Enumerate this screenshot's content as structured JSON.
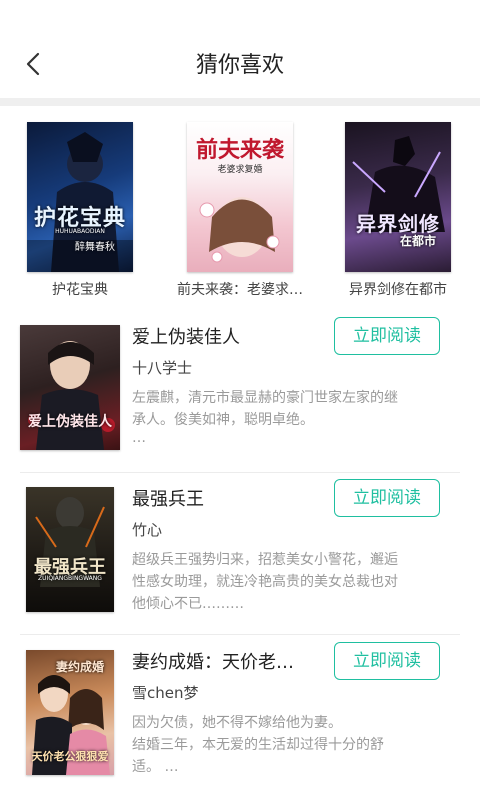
{
  "header": {
    "title": "猜你喜欢",
    "back_icon": "chevron-left-icon"
  },
  "featured": [
    {
      "title": "护花宝典",
      "cover_text": "护花宝典",
      "cover_sub": "醉舞春秋",
      "cover_en": "HUHUABAODIAN"
    },
    {
      "title": "前夫来袭：老婆求…",
      "cover_text": "前夫来袭",
      "cover_sub": "老婆求复婚"
    },
    {
      "title": "异界剑修在都市",
      "cover_text": "异界剑修",
      "cover_sub": "在都市"
    }
  ],
  "books": [
    {
      "title": "爱上伪装佳人",
      "author": "十八学士",
      "desc_lines": [
        "左震麒，清元市最显赫的豪门世家左家的继",
        "承人。俊美如神，聪明卓绝。",
        "…"
      ],
      "cover_text": "爱上伪装佳人",
      "button": "立即阅读"
    },
    {
      "title": "最强兵王",
      "author": "竹心",
      "desc_lines": [
        "超级兵王强势归来，招惹美女小警花，邂逅",
        "性感女助理，就连冷艳高贵的美女总裁也对",
        "他倾心不已………"
      ],
      "cover_text": "最强兵王",
      "cover_en": "ZUIQIANGBINGWANG",
      "button": "立即阅读"
    },
    {
      "title": "妻约成婚：天价老…",
      "author": "雪chen梦",
      "desc_lines": [
        "因为欠债，她不得不嫁给他为妻。",
        "结婚三年，本无爱的生活却过得十分的舒",
        "适。 …"
      ],
      "cover_text": "妻约成婚",
      "cover_sub": "天价老公狠狠爱",
      "button": "立即阅读"
    }
  ],
  "colors": {
    "accent": "#1fbfa0",
    "divider": "#efefef"
  }
}
